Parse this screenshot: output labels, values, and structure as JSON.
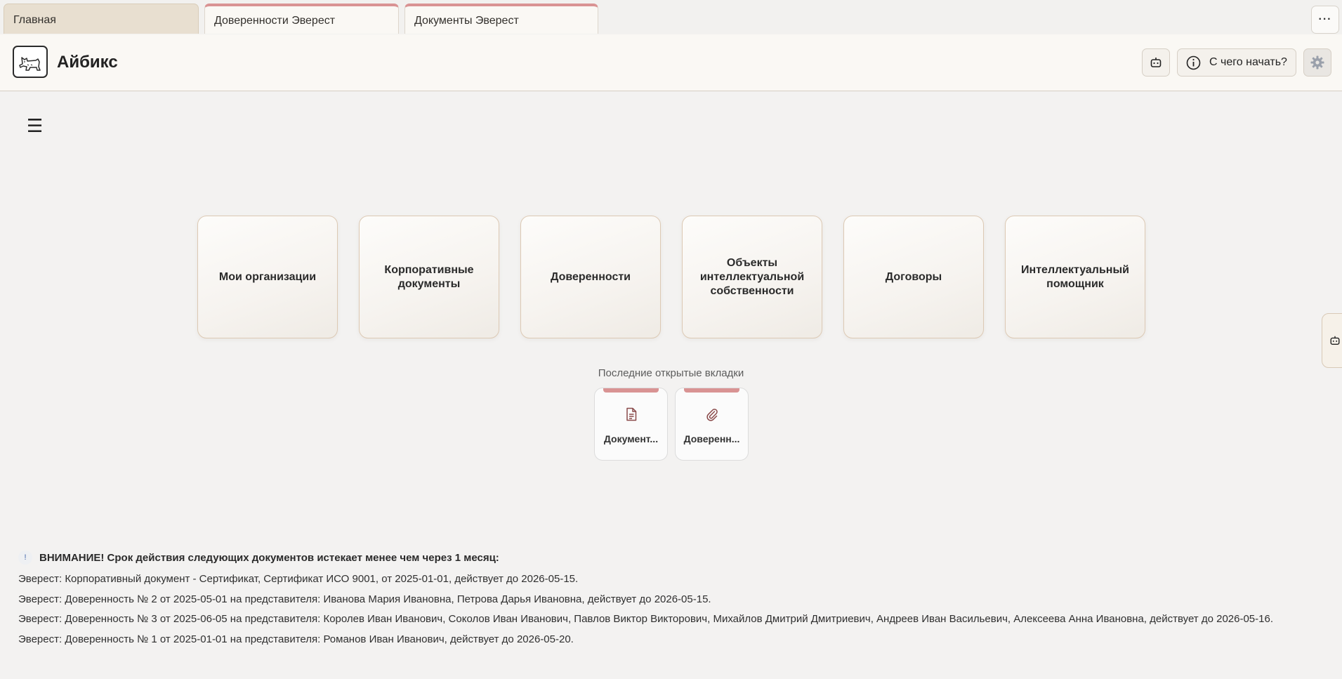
{
  "tabs": [
    {
      "label": "Главная",
      "active": true
    },
    {
      "label": "Доверенности Эверест",
      "active": false
    },
    {
      "label": "Документы Эверест",
      "active": false
    }
  ],
  "tabs_more_label": "···",
  "header": {
    "app_title": "Айбикс",
    "start_button_label": "С чего начать?"
  },
  "menu_icon": "☰",
  "cards": [
    "Мои организации",
    "Корпоративные\nдокументы",
    "Доверенности",
    "Объекты\nинтеллектуальной\nсобственности",
    "Договоры",
    "Интеллектуальный\nпомощник"
  ],
  "recent": {
    "title": "Последние открытые вкладки",
    "items": [
      {
        "label": "Документ...",
        "icon": "document-icon"
      },
      {
        "label": "Доверенн...",
        "icon": "paperclip-icon"
      }
    ]
  },
  "warnings": {
    "badge": "!",
    "title": "ВНИМАНИЕ! Срок действия следующих документов истекает менее чем через 1 месяц:",
    "lines": [
      "Эверест: Корпоративный документ - Сертификат, Сертификат ИСО 9001, от 2025-01-01, действует до 2026-05-15.",
      "Эверест: Доверенность № 2 от 2025-05-01 на представителя: Иванова Мария Ивановна, Петрова Дарья Ивановна, действует до 2026-05-15.",
      "Эверест: Доверенность № 3 от 2025-06-05 на представителя: Королев Иван Иванович, Соколов Иван Иванович, Павлов Виктор Викторович, Михайлов Дмитрий Дмитриевич, Андреев Иван Васильевич, Алексеева Анна Ивановна, действует до 2026-05-16.",
      "Эверест: Доверенность № 1 от 2025-01-01 на представителя: Романов Иван Иванович, действует до 2026-05-20."
    ]
  },
  "colors": {
    "active_tab": "#e8dfd0",
    "tab_accent": "#d99393",
    "header_bg": "#faf8f4",
    "page_bg": "#f3f2f1"
  }
}
